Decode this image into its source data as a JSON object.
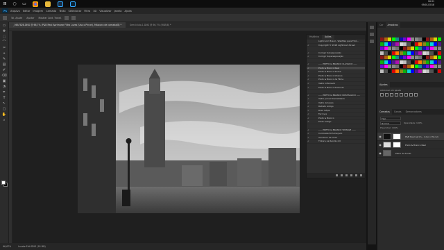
{
  "taskbar": {
    "clock_time": "18:31",
    "clock_date": "09/01/2018"
  },
  "menubar": {
    "logo": "Ps",
    "items": [
      "Arquivo",
      "Editar",
      "Imagem",
      "Camada",
      "Texto",
      "Selecionar",
      "Filtro",
      "3D",
      "Visualizar",
      "Janela",
      "Ajuda"
    ]
  },
  "options": {
    "items": [
      "Tol. Ajuste",
      "Ajustar",
      "Mostrar Cont. Transf."
    ]
  },
  "tools": [
    "▭",
    "✥",
    "⬚",
    "⌒",
    "✂",
    "⌖",
    "✎",
    "▤",
    "✐",
    "⌫",
    "▣",
    "◔",
    "✒",
    "T",
    "↖",
    "▢",
    "✋",
    "⌕"
  ],
  "doc_tabs": [
    {
      "label": "_06A7828.DNG @ 66,7% (P&B Real Aprimorar Filtro Luzes (Uso o Pincel), Máscara de camada/8) *",
      "active": true
    },
    {
      "label": "Sem-título-1.DNG @ 66,7% (RGB/8) *",
      "active": false
    }
  ],
  "status": {
    "zoom": "66,67%",
    "info": "Locate Edit DNG (18 MB)"
  },
  "actions_panel": {
    "tabs": [
      "Histórico",
      "Ações"
    ],
    "rows": [
      {
        "check": "",
        "label": "Lightroom Brasil - WebMax para Fotó...",
        "selected": false
      },
      {
        "check": "✓",
        "label": "Copyright © 2018 Lightroom Brasil",
        "selected": false
      },
      {
        "check": "",
        "label": "",
        "selected": false
      },
      {
        "check": "✓",
        "label": "Corrigir Subexposição",
        "selected": false
      },
      {
        "check": "✓",
        "label": "Corrigir Superexposição",
        "selected": false
      },
      {
        "check": "",
        "label": "",
        "selected": false
      },
      {
        "check": "✓",
        "label": "----- PRETO & BRANCO CLÁSSICO -----",
        "selected": false
      },
      {
        "check": "✓",
        "label": "Preto & Branco Real",
        "selected": true
      },
      {
        "check": "✓",
        "label": "Preto & Branco Suave",
        "selected": false
      },
      {
        "check": "✓",
        "label": "Preto & Branco Intenso",
        "selected": false
      },
      {
        "check": "✓",
        "label": "Preto & Branco de Filme",
        "selected": false
      },
      {
        "check": "✓",
        "label": "Velho Inflamado",
        "selected": false
      },
      {
        "check": "✓",
        "label": "Preto & Branco Profundo",
        "selected": false
      },
      {
        "check": "",
        "label": "",
        "selected": false
      },
      {
        "check": "✓",
        "label": "----- PRETO & BRANCO NOSTÁLGICO -----",
        "selected": false
      },
      {
        "check": "✓",
        "label": "Velho Jornal Dramatizado",
        "selected": false
      },
      {
        "check": "✓",
        "label": "Velho Amarelo",
        "selected": false
      },
      {
        "check": "✓",
        "label": "Retrato Antigo",
        "selected": false
      },
      {
        "check": "✓",
        "label": "Roxo Sépia",
        "selected": false
      },
      {
        "check": "✓",
        "label": "Ferrovia",
        "selected": false
      },
      {
        "check": "✓",
        "label": "Preto & Branco",
        "selected": false
      },
      {
        "check": "✓",
        "label": "Preto Antigo",
        "selected": false
      },
      {
        "check": "",
        "label": "",
        "selected": false
      },
      {
        "check": "✓",
        "label": "----- PRETO & BRANCO VINTAGE -----",
        "selected": false
      },
      {
        "check": "✓",
        "label": "Contraste Enfumaçado",
        "selected": false
      },
      {
        "check": "✓",
        "label": "Aerosaxo de Cinto",
        "selected": false
      },
      {
        "check": "✓",
        "label": "Tintura na Ranilla 2.0",
        "selected": false
      }
    ]
  },
  "right_panel": {
    "top_tabs": [
      "Cor",
      "Amostras"
    ],
    "adj_tabs": [
      "Ajustes"
    ],
    "adj_label": "Adicionar um ajuste",
    "layers_tabs": [
      "Camadas",
      "Canais",
      "Demarcadores"
    ],
    "kind_filter": "Tipo",
    "blend_mode": "Normal",
    "opacity": "Opacidade: 100%",
    "fill": "Preencher: 100%",
    "layers": [
      {
        "name": "P&B Real Aprim... (Uso o Pincel)",
        "selected": true
      },
      {
        "name": "Preto & Branco Real",
        "selected": false
      },
      {
        "name": "Plano de fundo",
        "selected": false
      }
    ]
  },
  "swatch_colors": [
    "#ff0000",
    "#ff8000",
    "#ffff00",
    "#00ff00",
    "#00ffff",
    "#0000ff",
    "#8000ff",
    "#ff00ff",
    "#ffffff",
    "#c0c0c0",
    "#808080",
    "#000000"
  ]
}
